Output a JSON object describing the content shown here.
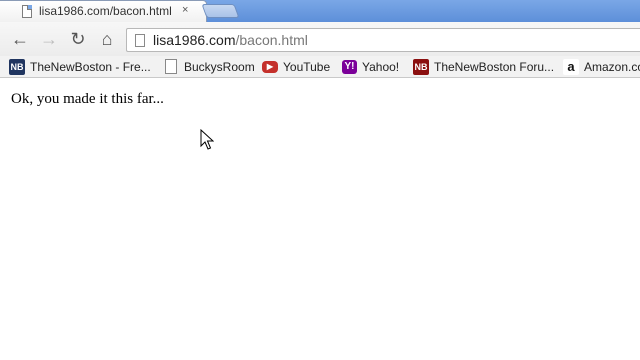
{
  "tab": {
    "title": "lisa1986.com/bacon.html",
    "close_glyph": "×"
  },
  "toolbar": {
    "back_glyph": "←",
    "forward_glyph": "→",
    "reload_glyph": "↻",
    "home_glyph": "⌂",
    "url_host": "lisa1986.com",
    "url_path": "/bacon.html"
  },
  "bookmarks": [
    {
      "label": "TheNewBoston - Fre...",
      "icon": "nb-icon",
      "icon_text": "NB"
    },
    {
      "label": "BuckysRoom",
      "icon": "page-icon",
      "icon_text": ""
    },
    {
      "label": "YouTube",
      "icon": "youtube-icon",
      "icon_text": "▶"
    },
    {
      "label": "Yahoo!",
      "icon": "yahoo-icon",
      "icon_text": "Y!"
    },
    {
      "label": "TheNewBoston Foru...",
      "icon": "nb-forum-icon",
      "icon_text": "NB"
    },
    {
      "label": "Amazon.co",
      "icon": "amazon-icon",
      "icon_text": "a"
    }
  ],
  "page": {
    "message": "Ok, you made it this far..."
  }
}
